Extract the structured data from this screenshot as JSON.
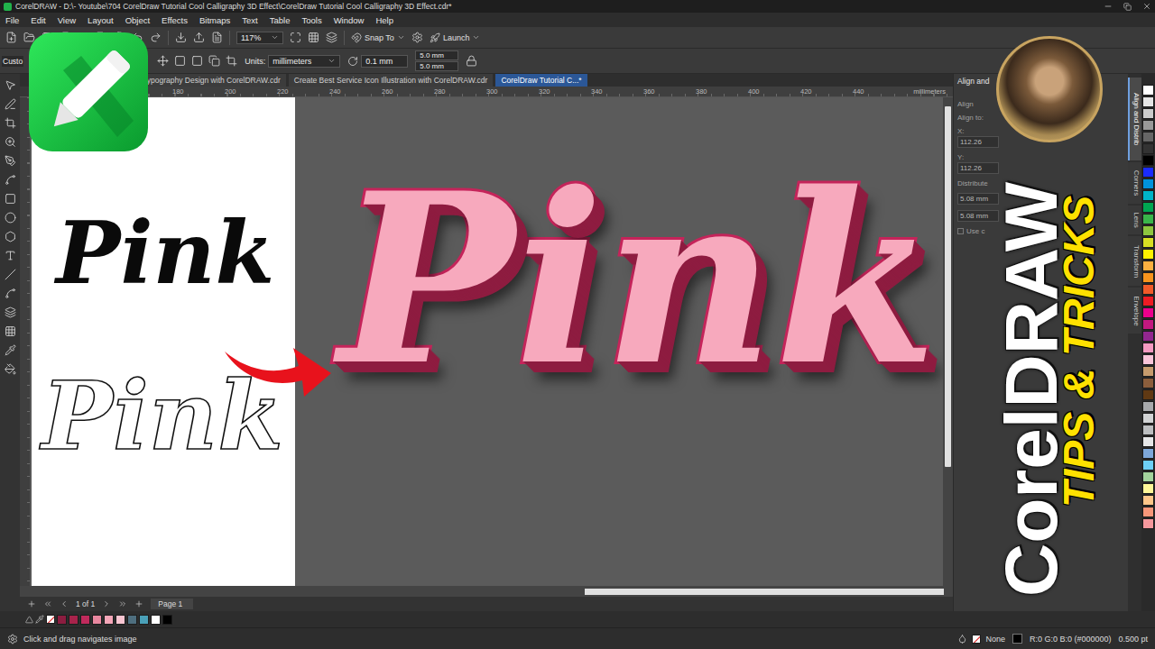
{
  "window": {
    "title": "CorelDRAW - D:\\- Youtube\\704 CorelDraw Tutorial Cool Calligraphy 3D Effect\\CorelDraw Tutorial Cool Calligraphy 3D Effect.cdr*"
  },
  "menu": [
    "File",
    "Edit",
    "View",
    "Layout",
    "Object",
    "Effects",
    "Bitmaps",
    "Text",
    "Table",
    "Tools",
    "Window",
    "Help"
  ],
  "toolbar": {
    "zoom": "117%",
    "snap": "Snap To",
    "launch": "Launch"
  },
  "property_bar": {
    "preset": "Custo",
    "units_label": "Units:",
    "units": "millimeters",
    "nudge": "0.1 mm",
    "duplicate": [
      "5.0 mm",
      "5.0 mm"
    ]
  },
  "document_tabs": [
    {
      "label": "Typography Design with CorelDRAW.cdr",
      "selected": false
    },
    {
      "label": "Create Best Service Icon Illustration with CorelDRAW.cdr",
      "selected": false
    },
    {
      "label": "CorelDraw Tutorial C...*",
      "selected": true
    }
  ],
  "ruler": {
    "ticks": [
      "180",
      "200",
      "220",
      "240",
      "260",
      "280",
      "300",
      "320",
      "340",
      "360",
      "380",
      "400",
      "420",
      "440"
    ],
    "unit": "millimeters"
  },
  "artwork": [
    {
      "text": "Pink",
      "kind": "solid"
    },
    {
      "text": "Pink",
      "kind": "outline"
    },
    {
      "text": "Pink",
      "kind": "extruded"
    }
  ],
  "pager": {
    "count": "1 of 1",
    "page": "Page 1"
  },
  "docker": {
    "title": "Align and",
    "labels": [
      "Align",
      "Align to:"
    ],
    "coords": [
      {
        "label": "X:",
        "value": "112.26"
      },
      {
        "label": "Y:",
        "value": "112.26"
      }
    ],
    "section": "Distribute",
    "sizes": [
      "5.08 mm",
      "5.08 mm"
    ],
    "option": "Use c"
  },
  "docker_tabs": [
    {
      "label": "Align and Distrib",
      "selected": true
    },
    {
      "label": "Corners",
      "selected": false
    },
    {
      "label": "Lens",
      "selected": false
    },
    {
      "label": "Transform",
      "selected": false
    },
    {
      "label": "Envelope",
      "selected": false
    }
  ],
  "side_palette": [
    {
      "color": "#ffffff"
    },
    {
      "color": "#e6e6e6"
    },
    {
      "color": "#cccccc"
    },
    {
      "color": "#999999"
    },
    {
      "color": "#666666"
    },
    {
      "color": "#333333"
    },
    {
      "color": "#000000"
    },
    {
      "color": "#1a2cff"
    },
    {
      "color": "#0093dd"
    },
    {
      "color": "#00b4c8"
    },
    {
      "color": "#00a651"
    },
    {
      "color": "#39b54a"
    },
    {
      "color": "#8dc63f"
    },
    {
      "color": "#d7df23"
    },
    {
      "color": "#fff200"
    },
    {
      "color": "#fbb040"
    },
    {
      "color": "#f7941d"
    },
    {
      "color": "#f15a29"
    },
    {
      "color": "#ed1c24"
    },
    {
      "color": "#ec008c"
    },
    {
      "color": "#c2187f"
    },
    {
      "color": "#92278f"
    },
    {
      "color": "#f49ac1"
    },
    {
      "color": "#f9c5d9"
    },
    {
      "color": "#c69c6d"
    },
    {
      "color": "#8b5e3c"
    },
    {
      "color": "#603913"
    },
    {
      "color": "#a7a9ac"
    },
    {
      "color": "#d1d3d4"
    },
    {
      "color": "#bcbec0"
    },
    {
      "color": "#e6e7e8"
    },
    {
      "color": "#7da7d9"
    },
    {
      "color": "#6dcff6"
    },
    {
      "color": "#a3d39c"
    },
    {
      "color": "#fff799"
    },
    {
      "color": "#fdc689"
    },
    {
      "color": "#f69679"
    },
    {
      "color": "#f6989d"
    }
  ],
  "bottom_palette": [
    {
      "color": "#8c1d40"
    },
    {
      "color": "#a8234b"
    },
    {
      "color": "#c02a5c"
    },
    {
      "color": "#e8879f"
    },
    {
      "color": "#f4a6b8"
    },
    {
      "color": "#f8c5d1"
    },
    {
      "color": "#4e6e7e"
    },
    {
      "color": "#4aa0b8"
    },
    {
      "color": "#ffffff"
    },
    {
      "color": "#000000"
    }
  ],
  "status_bar": {
    "hint": "Click and drag navigates image",
    "fill": "None",
    "outline": "R:0 G:0 B:0 (#000000)",
    "width": "0.500 pt"
  },
  "thumbnail": {
    "brand": "CorelDRAW",
    "tagline": "TIPS & TRICKS"
  }
}
